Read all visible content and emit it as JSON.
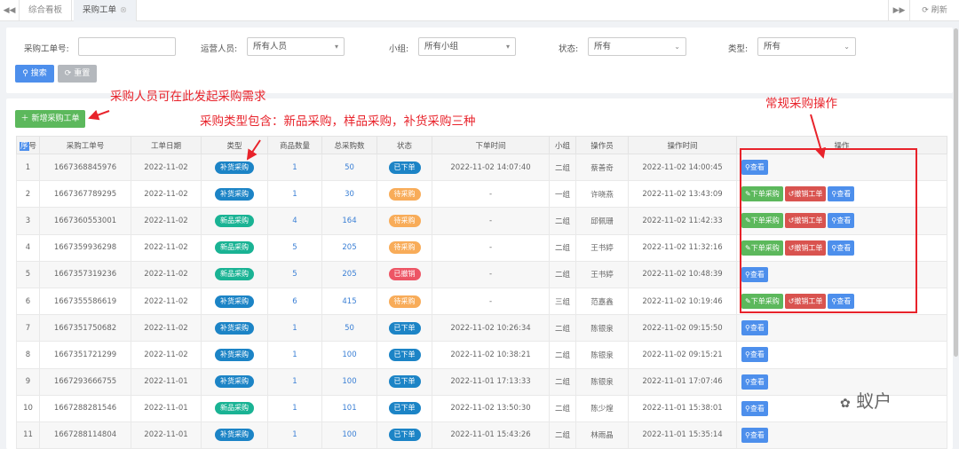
{
  "tabs": [
    {
      "label": "综合看板"
    },
    {
      "label": "采购工单"
    }
  ],
  "topbar": {
    "refresh_label": "刷新"
  },
  "filter": {
    "order_no_label": "采购工单号:",
    "order_no_value": "",
    "operator_label": "运营人员:",
    "operator_value": "所有人员",
    "group_label": "小组:",
    "group_value": "所有小组",
    "status_label": "状态:",
    "status_value": "所有",
    "type_label": "类型:",
    "type_value": "所有",
    "search_label": "搜索",
    "reset_label": "重置"
  },
  "toolbar": {
    "new_order_label": "新增采购工单"
  },
  "annotations": {
    "note1": "采购人员可在此发起采购需求",
    "note2": "采购类型包含：新品采购，样品采购，补货采购三种",
    "note3": "常规采购操作"
  },
  "table": {
    "headers": [
      "序号",
      "采购工单号",
      "工单日期",
      "类型",
      "商品数量",
      "总采购数",
      "状态",
      "下单时间",
      "小组",
      "操作员",
      "操作时间",
      "操作"
    ],
    "rows": [
      {
        "seq": "1",
        "order_no": "1667368845976",
        "date": "2022-11-02",
        "type": "补货采购",
        "qty": "1",
        "total": "50",
        "status": "已下单",
        "order_time": "2022-11-02 14:07:40",
        "group": "二组",
        "operator": "蔡善奇",
        "op_time": "2022-11-02 14:00:45",
        "actions": [
          "查看"
        ]
      },
      {
        "seq": "2",
        "order_no": "1667367789295",
        "date": "2022-11-02",
        "type": "补货采购",
        "qty": "1",
        "total": "30",
        "status": "待采购",
        "order_time": "-",
        "group": "一组",
        "operator": "许晓燕",
        "op_time": "2022-11-02 13:43:09",
        "actions": [
          "下单采购",
          "撤销工单",
          "查看"
        ]
      },
      {
        "seq": "3",
        "order_no": "1667360553001",
        "date": "2022-11-02",
        "type": "新品采购",
        "qty": "4",
        "total": "164",
        "status": "待采购",
        "order_time": "-",
        "group": "二组",
        "operator": "邱佩珊",
        "op_time": "2022-11-02 11:42:33",
        "actions": [
          "下单采购",
          "撤销工单",
          "查看"
        ]
      },
      {
        "seq": "4",
        "order_no": "1667359936298",
        "date": "2022-11-02",
        "type": "新品采购",
        "qty": "5",
        "total": "205",
        "status": "待采购",
        "order_time": "-",
        "group": "二组",
        "operator": "王书婷",
        "op_time": "2022-11-02 11:32:16",
        "actions": [
          "下单采购",
          "撤销工单",
          "查看"
        ]
      },
      {
        "seq": "5",
        "order_no": "1667357319236",
        "date": "2022-11-02",
        "type": "新品采购",
        "qty": "5",
        "total": "205",
        "status": "已撤销",
        "order_time": "-",
        "group": "二组",
        "operator": "王书婷",
        "op_time": "2022-11-02 10:48:39",
        "actions": [
          "查看"
        ]
      },
      {
        "seq": "6",
        "order_no": "1667355586619",
        "date": "2022-11-02",
        "type": "补货采购",
        "qty": "6",
        "total": "415",
        "status": "待采购",
        "order_time": "-",
        "group": "三组",
        "operator": "范嘉鑫",
        "op_time": "2022-11-02 10:19:46",
        "actions": [
          "下单采购",
          "撤销工单",
          "查看"
        ]
      },
      {
        "seq": "7",
        "order_no": "1667351750682",
        "date": "2022-11-02",
        "type": "补货采购",
        "qty": "1",
        "total": "50",
        "status": "已下单",
        "order_time": "2022-11-02 10:26:34",
        "group": "二组",
        "operator": "陈银泉",
        "op_time": "2022-11-02 09:15:50",
        "actions": [
          "查看"
        ]
      },
      {
        "seq": "8",
        "order_no": "1667351721299",
        "date": "2022-11-02",
        "type": "补货采购",
        "qty": "1",
        "total": "100",
        "status": "已下单",
        "order_time": "2022-11-02 10:38:21",
        "group": "二组",
        "operator": "陈银泉",
        "op_time": "2022-11-02 09:15:21",
        "actions": [
          "查看"
        ]
      },
      {
        "seq": "9",
        "order_no": "1667293666755",
        "date": "2022-11-01",
        "type": "补货采购",
        "qty": "1",
        "total": "100",
        "status": "已下单",
        "order_time": "2022-11-01 17:13:33",
        "group": "二组",
        "operator": "陈银泉",
        "op_time": "2022-11-01 17:07:46",
        "actions": [
          "查看"
        ]
      },
      {
        "seq": "10",
        "order_no": "1667288281546",
        "date": "2022-11-01",
        "type": "新品采购",
        "qty": "1",
        "total": "101",
        "status": "已下单",
        "order_time": "2022-11-02 13:50:30",
        "group": "二组",
        "operator": "陈少煌",
        "op_time": "2022-11-01 15:38:01",
        "actions": [
          "查看"
        ]
      },
      {
        "seq": "11",
        "order_no": "1667288114804",
        "date": "2022-11-01",
        "type": "补货采购",
        "qty": "1",
        "total": "100",
        "status": "已下单",
        "order_time": "2022-11-01 15:43:26",
        "group": "二组",
        "operator": "林雨晶",
        "op_time": "2022-11-01 15:35:14",
        "actions": [
          "查看"
        ]
      }
    ]
  },
  "colors": {
    "type": {
      "补货采购": "#1c84c6",
      "新品采购": "#1ab394"
    },
    "status": {
      "已下单": "#1c84c6",
      "待采购": "#f8ac59",
      "已撤销": "#ed5565"
    },
    "action": {
      "下单采购": "b-g",
      "撤销工单": "b-r",
      "查看": "b-b"
    },
    "action_icon": {
      "下单采购": "✎",
      "撤销工单": "↺",
      "查看": "🔍"
    }
  },
  "watermark": "蚁户"
}
